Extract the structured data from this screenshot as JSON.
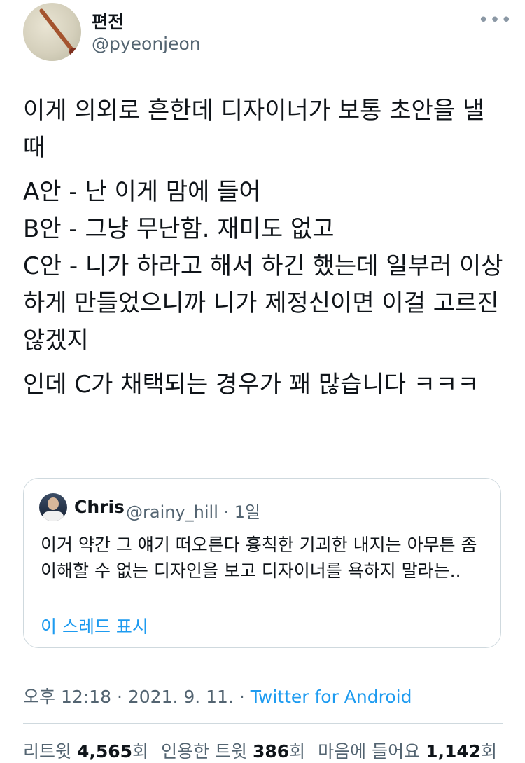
{
  "author": {
    "display_name": "편전",
    "handle": "@pyeonjeon"
  },
  "more_icon": "more-horizontal-icon",
  "tweet": {
    "paragraphs": [
      "이게 의외로 흔한데 디자이너가 보통 초안을 낼때",
      "A안 - 난 이게 맘에 들어\nB안 - 그냥 무난함. 재미도 없고\nC안 - 니가 하라고 해서 하긴 했는데 일부러 이상하게 만들었으니까 니가 제정신이면 이걸 고르진 않겠지",
      "인데 C가 채택되는 경우가 꽤 많습니다 ㅋㅋㅋ"
    ]
  },
  "quote": {
    "name": "Chris",
    "meta": "@rainy_hill · 1일",
    "text": "이거 약간 그 얘기 떠오른다 흉칙한 기괴한 내지는 아무튼 좀 이해할 수 없는 디자인을 보고 디자이너를 욕하지 말라는..",
    "thread_link": "이 스레드 표시"
  },
  "timestamp": "오후 12:18 · 2021. 9. 11. · ",
  "source": "Twitter for Android",
  "stats": {
    "retweet_label": "리트윗",
    "retweet_count": "4,565",
    "retweet_unit": "회",
    "quote_label": "인용한 트윗",
    "quote_count": "386",
    "quote_unit": "회",
    "like_label": "마음에 들어요",
    "like_count": "1,142",
    "like_unit": "회"
  },
  "colors": {
    "link": "#1d9bf0",
    "secondary_text": "#536471",
    "border": "#cfd9de"
  }
}
